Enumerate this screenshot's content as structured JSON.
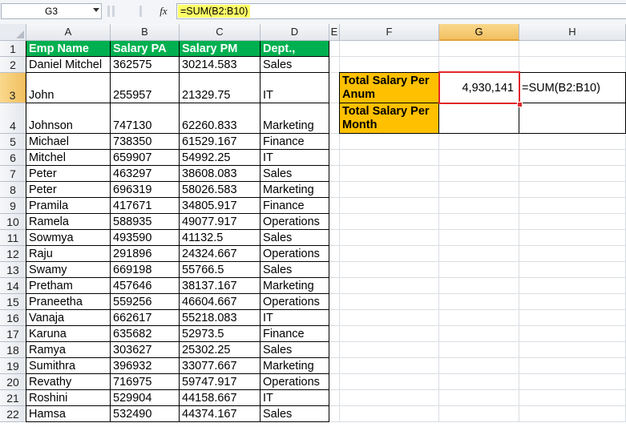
{
  "formula_bar": {
    "name_box": "G3",
    "fx_label": "fx",
    "formula": "=SUM(B2:B10)"
  },
  "columns": [
    "A",
    "B",
    "C",
    "D",
    "E",
    "F",
    "G",
    "H"
  ],
  "selected_column": "G",
  "selected_row": "3",
  "rows": [
    "1",
    "2",
    "3",
    "4",
    "5",
    "6",
    "7",
    "8",
    "9",
    "10",
    "11",
    "12",
    "13",
    "14",
    "15",
    "16",
    "17",
    "18",
    "19",
    "20",
    "21",
    "22"
  ],
  "table": {
    "headers": [
      "Emp Name",
      "Salary PA",
      "Salary PM",
      "Dept.,"
    ],
    "rows": [
      [
        "Daniel Mitchel",
        "362575",
        "30214.583",
        "Sales"
      ],
      [
        "John",
        "255957",
        "21329.75",
        "IT"
      ],
      [
        "Johnson",
        "747130",
        "62260.833",
        "Marketing"
      ],
      [
        "Michael",
        "738350",
        "61529.167",
        "Finance"
      ],
      [
        "Mitchel",
        "659907",
        "54992.25",
        "IT"
      ],
      [
        "Peter",
        "463297",
        "38608.083",
        "Sales"
      ],
      [
        "Peter",
        "696319",
        "58026.583",
        "Marketing"
      ],
      [
        "Pramila",
        "417671",
        "34805.917",
        "Finance"
      ],
      [
        "Ramela",
        "588935",
        "49077.917",
        "Operations"
      ],
      [
        "Sowmya",
        "493590",
        "41132.5",
        "Sales"
      ],
      [
        "Raju",
        "291896",
        "24324.667",
        "Operations"
      ],
      [
        "Swamy",
        "669198",
        "55766.5",
        "Sales"
      ],
      [
        "Pretham",
        "457646",
        "38137.167",
        "Marketing"
      ],
      [
        "Praneetha",
        "559256",
        "46604.667",
        "Operations"
      ],
      [
        "Vanaja",
        "662617",
        "55218.083",
        "IT"
      ],
      [
        "Karuna",
        "635682",
        "52973.5",
        "Finance"
      ],
      [
        "Ramya",
        "303627",
        "25302.25",
        "Sales"
      ],
      [
        "Sumithra",
        "396932",
        "33077.667",
        "Marketing"
      ],
      [
        "Revathy",
        "716975",
        "59747.917",
        "Operations"
      ],
      [
        "Roshini",
        "529904",
        "44158.667",
        "IT"
      ],
      [
        "Hamsa",
        "532490",
        "44374.167",
        "Sales"
      ]
    ]
  },
  "summary": {
    "total_pa_label": "Total Salary Per Anum",
    "total_pa_value": "4,930,141",
    "total_pa_formula": "=SUM(B2:B10)",
    "total_pm_label": "Total Salary Per Month",
    "total_pm_value": "",
    "total_pm_formula": ""
  },
  "colors": {
    "header_green": "#00b050",
    "label_orange": "#ffc000",
    "selection_red": "#e0272c",
    "formula_highlight": "#ffff66"
  }
}
